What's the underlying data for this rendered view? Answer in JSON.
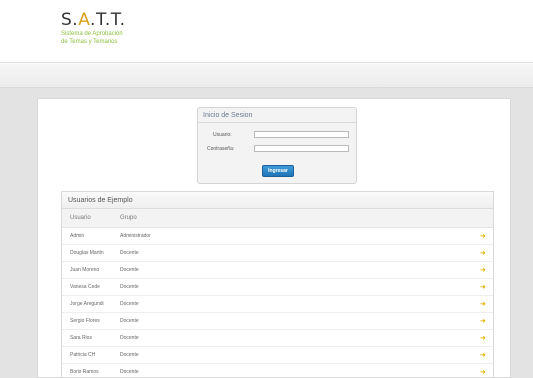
{
  "logo": {
    "prefix": "S.",
    "accent": "A",
    "suffix": ".T.T.",
    "subtitle_line1": "Sistema de Aprobación",
    "subtitle_line2": "de Temas y Temarios"
  },
  "login": {
    "title": "Inicio de Sesion",
    "user_label": "Usuario:",
    "password_label": "Contraseña:",
    "user_value": "",
    "password_value": "",
    "submit_label": "Ingresar"
  },
  "users": {
    "title": "Usuarios de Ejemplo",
    "columns": [
      "Usuario",
      "Grupo"
    ],
    "rows": [
      {
        "usuario": "Admin",
        "grupo": "Administrador"
      },
      {
        "usuario": "Douglas Martin",
        "grupo": "Docente"
      },
      {
        "usuario": "Juan Moreno",
        "grupo": "Docente"
      },
      {
        "usuario": "Vanesa Cede",
        "grupo": "Docente"
      },
      {
        "usuario": "Jorge Aregundi",
        "grupo": "Docente"
      },
      {
        "usuario": "Sergio Flores",
        "grupo": "Docente"
      },
      {
        "usuario": "Sara Rios",
        "grupo": "Docente"
      },
      {
        "usuario": "Patricia CH",
        "grupo": "Docente"
      },
      {
        "usuario": "Boris Ramos",
        "grupo": "Docente"
      }
    ]
  },
  "colors": {
    "accent": "#d7a21a",
    "subtitle": "#8cbf3f",
    "button": "#2a84c6",
    "arrow": "#e4b100"
  },
  "icons": {
    "row_action": "arrow-right-icon"
  }
}
